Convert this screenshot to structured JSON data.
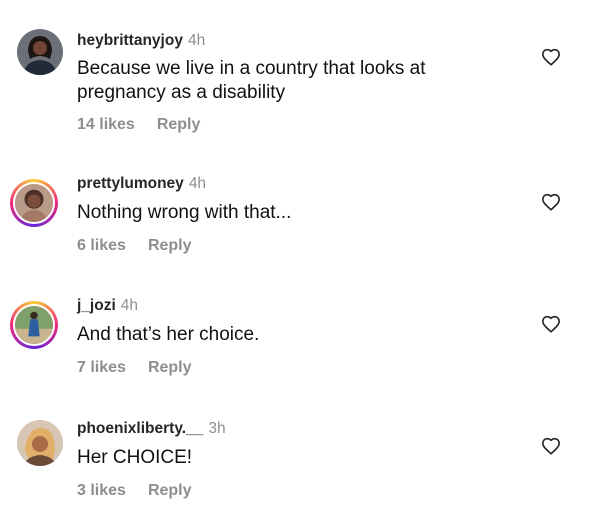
{
  "comments": [
    {
      "username": "heybrittanyjoy",
      "time": "4h",
      "text": "Because we live in a country that looks at pregnancy as a disability",
      "likes": "14 likes",
      "reply": "Reply",
      "avatar_icon": "profile-photo-avatar",
      "heart_icon": "heart-outline-icon"
    },
    {
      "username": "prettylumoney",
      "time": "4h",
      "text": "Nothing wrong with that...",
      "likes": "6 likes",
      "reply": "Reply",
      "avatar_icon": "profile-photo-avatar-story-ring",
      "heart_icon": "heart-outline-icon"
    },
    {
      "username": "j_jozi",
      "time": "4h",
      "text": "And that’s her choice.",
      "likes": "7 likes",
      "reply": "Reply",
      "avatar_icon": "profile-photo-avatar-story-ring",
      "heart_icon": "heart-outline-icon"
    },
    {
      "username": "phoenixliberty.__",
      "time": "3h",
      "text": "Her CHOICE!",
      "likes": "3 likes",
      "reply": "Reply",
      "avatar_icon": "profile-photo-avatar",
      "heart_icon": "heart-outline-icon"
    }
  ],
  "colors": {
    "text": "#111111",
    "username": "#262626",
    "secondary": "#8e8e8e",
    "story_ring_start": "#f9ce34",
    "story_ring_mid": "#ee2a7b",
    "story_ring_end": "#6228d7"
  }
}
